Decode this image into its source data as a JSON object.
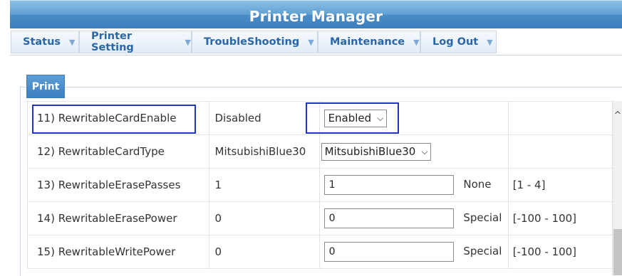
{
  "header": {
    "title": "Printer Manager"
  },
  "menu": [
    {
      "label": "Status",
      "caret": "▼"
    },
    {
      "label": "Printer Setting",
      "caret": "▼"
    },
    {
      "label": "TroubleShooting",
      "caret": "▼"
    },
    {
      "label": "Maintenance",
      "caret": "▼"
    },
    {
      "label": "Log Out",
      "caret": "▼"
    }
  ],
  "section": {
    "legend": "Print"
  },
  "rows": [
    {
      "label": "11) RewritableCardEnable",
      "current": "Disabled",
      "control": "select",
      "value": "Enabled",
      "unit": "",
      "range": ""
    },
    {
      "label": "12) RewritableCardType",
      "current": "MitsubishiBlue30",
      "control": "select",
      "value": "MitsubishiBlue30",
      "unit": "",
      "range": ""
    },
    {
      "label": "13) RewritableErasePasses",
      "current": "1",
      "control": "input",
      "value": "1",
      "unit": "None",
      "range": "[1 - 4]"
    },
    {
      "label": "14) RewritableErasePower",
      "current": "0",
      "control": "input",
      "value": "0",
      "unit": "Special",
      "range": "[-100 - 100]"
    },
    {
      "label": "15) RewritableWritePower",
      "current": "0",
      "control": "input",
      "value": "0",
      "unit": "Special",
      "range": "[-100 - 100]"
    }
  ],
  "icons": {
    "select_arrow": "⌵",
    "scroll_up": "^"
  },
  "colors": {
    "header": "#4a8cc6",
    "menu_text": "#2a66a8",
    "highlight": "#1f35c8"
  }
}
